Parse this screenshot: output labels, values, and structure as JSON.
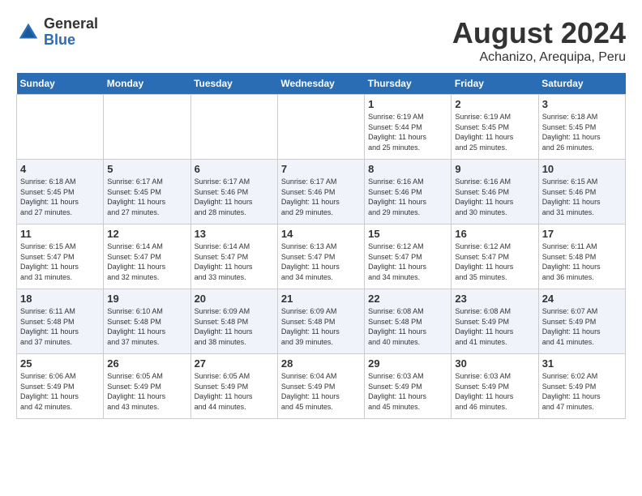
{
  "logo": {
    "general": "General",
    "blue": "Blue"
  },
  "title": "August 2024",
  "location": "Achanizo, Arequipa, Peru",
  "weekdays": [
    "Sunday",
    "Monday",
    "Tuesday",
    "Wednesday",
    "Thursday",
    "Friday",
    "Saturday"
  ],
  "weeks": [
    [
      {
        "day": "",
        "info": ""
      },
      {
        "day": "",
        "info": ""
      },
      {
        "day": "",
        "info": ""
      },
      {
        "day": "",
        "info": ""
      },
      {
        "day": "1",
        "info": "Sunrise: 6:19 AM\nSunset: 5:44 PM\nDaylight: 11 hours\nand 25 minutes."
      },
      {
        "day": "2",
        "info": "Sunrise: 6:19 AM\nSunset: 5:45 PM\nDaylight: 11 hours\nand 25 minutes."
      },
      {
        "day": "3",
        "info": "Sunrise: 6:18 AM\nSunset: 5:45 PM\nDaylight: 11 hours\nand 26 minutes."
      }
    ],
    [
      {
        "day": "4",
        "info": "Sunrise: 6:18 AM\nSunset: 5:45 PM\nDaylight: 11 hours\nand 27 minutes."
      },
      {
        "day": "5",
        "info": "Sunrise: 6:17 AM\nSunset: 5:45 PM\nDaylight: 11 hours\nand 27 minutes."
      },
      {
        "day": "6",
        "info": "Sunrise: 6:17 AM\nSunset: 5:46 PM\nDaylight: 11 hours\nand 28 minutes."
      },
      {
        "day": "7",
        "info": "Sunrise: 6:17 AM\nSunset: 5:46 PM\nDaylight: 11 hours\nand 29 minutes."
      },
      {
        "day": "8",
        "info": "Sunrise: 6:16 AM\nSunset: 5:46 PM\nDaylight: 11 hours\nand 29 minutes."
      },
      {
        "day": "9",
        "info": "Sunrise: 6:16 AM\nSunset: 5:46 PM\nDaylight: 11 hours\nand 30 minutes."
      },
      {
        "day": "10",
        "info": "Sunrise: 6:15 AM\nSunset: 5:46 PM\nDaylight: 11 hours\nand 31 minutes."
      }
    ],
    [
      {
        "day": "11",
        "info": "Sunrise: 6:15 AM\nSunset: 5:47 PM\nDaylight: 11 hours\nand 31 minutes."
      },
      {
        "day": "12",
        "info": "Sunrise: 6:14 AM\nSunset: 5:47 PM\nDaylight: 11 hours\nand 32 minutes."
      },
      {
        "day": "13",
        "info": "Sunrise: 6:14 AM\nSunset: 5:47 PM\nDaylight: 11 hours\nand 33 minutes."
      },
      {
        "day": "14",
        "info": "Sunrise: 6:13 AM\nSunset: 5:47 PM\nDaylight: 11 hours\nand 34 minutes."
      },
      {
        "day": "15",
        "info": "Sunrise: 6:12 AM\nSunset: 5:47 PM\nDaylight: 11 hours\nand 34 minutes."
      },
      {
        "day": "16",
        "info": "Sunrise: 6:12 AM\nSunset: 5:47 PM\nDaylight: 11 hours\nand 35 minutes."
      },
      {
        "day": "17",
        "info": "Sunrise: 6:11 AM\nSunset: 5:48 PM\nDaylight: 11 hours\nand 36 minutes."
      }
    ],
    [
      {
        "day": "18",
        "info": "Sunrise: 6:11 AM\nSunset: 5:48 PM\nDaylight: 11 hours\nand 37 minutes."
      },
      {
        "day": "19",
        "info": "Sunrise: 6:10 AM\nSunset: 5:48 PM\nDaylight: 11 hours\nand 37 minutes."
      },
      {
        "day": "20",
        "info": "Sunrise: 6:09 AM\nSunset: 5:48 PM\nDaylight: 11 hours\nand 38 minutes."
      },
      {
        "day": "21",
        "info": "Sunrise: 6:09 AM\nSunset: 5:48 PM\nDaylight: 11 hours\nand 39 minutes."
      },
      {
        "day": "22",
        "info": "Sunrise: 6:08 AM\nSunset: 5:48 PM\nDaylight: 11 hours\nand 40 minutes."
      },
      {
        "day": "23",
        "info": "Sunrise: 6:08 AM\nSunset: 5:49 PM\nDaylight: 11 hours\nand 41 minutes."
      },
      {
        "day": "24",
        "info": "Sunrise: 6:07 AM\nSunset: 5:49 PM\nDaylight: 11 hours\nand 41 minutes."
      }
    ],
    [
      {
        "day": "25",
        "info": "Sunrise: 6:06 AM\nSunset: 5:49 PM\nDaylight: 11 hours\nand 42 minutes."
      },
      {
        "day": "26",
        "info": "Sunrise: 6:05 AM\nSunset: 5:49 PM\nDaylight: 11 hours\nand 43 minutes."
      },
      {
        "day": "27",
        "info": "Sunrise: 6:05 AM\nSunset: 5:49 PM\nDaylight: 11 hours\nand 44 minutes."
      },
      {
        "day": "28",
        "info": "Sunrise: 6:04 AM\nSunset: 5:49 PM\nDaylight: 11 hours\nand 45 minutes."
      },
      {
        "day": "29",
        "info": "Sunrise: 6:03 AM\nSunset: 5:49 PM\nDaylight: 11 hours\nand 45 minutes."
      },
      {
        "day": "30",
        "info": "Sunrise: 6:03 AM\nSunset: 5:49 PM\nDaylight: 11 hours\nand 46 minutes."
      },
      {
        "day": "31",
        "info": "Sunrise: 6:02 AM\nSunset: 5:49 PM\nDaylight: 11 hours\nand 47 minutes."
      }
    ]
  ]
}
